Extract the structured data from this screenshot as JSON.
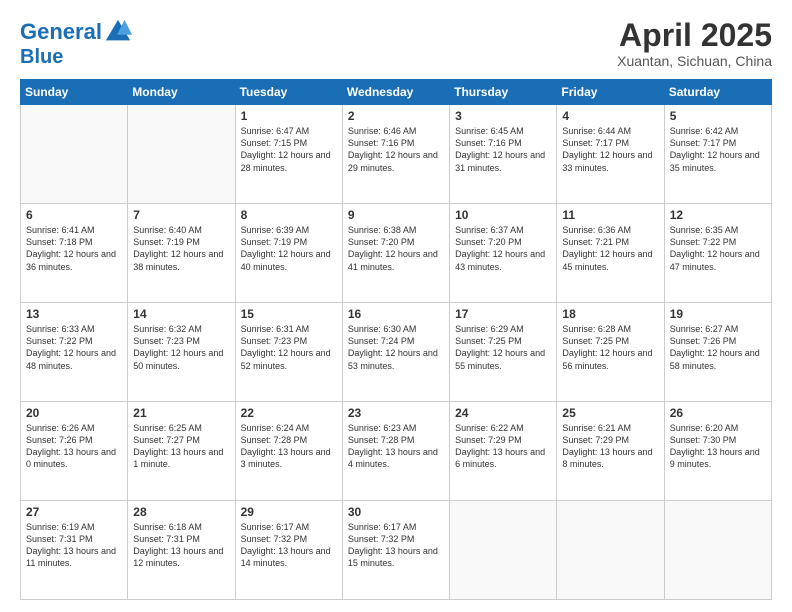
{
  "logo": {
    "line1": "General",
    "line2": "Blue"
  },
  "title": "April 2025",
  "subtitle": "Xuantan, Sichuan, China",
  "days_of_week": [
    "Sunday",
    "Monday",
    "Tuesday",
    "Wednesday",
    "Thursday",
    "Friday",
    "Saturday"
  ],
  "weeks": [
    [
      {
        "day": "",
        "info": ""
      },
      {
        "day": "",
        "info": ""
      },
      {
        "day": "1",
        "info": "Sunrise: 6:47 AM\nSunset: 7:15 PM\nDaylight: 12 hours and 28 minutes."
      },
      {
        "day": "2",
        "info": "Sunrise: 6:46 AM\nSunset: 7:16 PM\nDaylight: 12 hours and 29 minutes."
      },
      {
        "day": "3",
        "info": "Sunrise: 6:45 AM\nSunset: 7:16 PM\nDaylight: 12 hours and 31 minutes."
      },
      {
        "day": "4",
        "info": "Sunrise: 6:44 AM\nSunset: 7:17 PM\nDaylight: 12 hours and 33 minutes."
      },
      {
        "day": "5",
        "info": "Sunrise: 6:42 AM\nSunset: 7:17 PM\nDaylight: 12 hours and 35 minutes."
      }
    ],
    [
      {
        "day": "6",
        "info": "Sunrise: 6:41 AM\nSunset: 7:18 PM\nDaylight: 12 hours and 36 minutes."
      },
      {
        "day": "7",
        "info": "Sunrise: 6:40 AM\nSunset: 7:19 PM\nDaylight: 12 hours and 38 minutes."
      },
      {
        "day": "8",
        "info": "Sunrise: 6:39 AM\nSunset: 7:19 PM\nDaylight: 12 hours and 40 minutes."
      },
      {
        "day": "9",
        "info": "Sunrise: 6:38 AM\nSunset: 7:20 PM\nDaylight: 12 hours and 41 minutes."
      },
      {
        "day": "10",
        "info": "Sunrise: 6:37 AM\nSunset: 7:20 PM\nDaylight: 12 hours and 43 minutes."
      },
      {
        "day": "11",
        "info": "Sunrise: 6:36 AM\nSunset: 7:21 PM\nDaylight: 12 hours and 45 minutes."
      },
      {
        "day": "12",
        "info": "Sunrise: 6:35 AM\nSunset: 7:22 PM\nDaylight: 12 hours and 47 minutes."
      }
    ],
    [
      {
        "day": "13",
        "info": "Sunrise: 6:33 AM\nSunset: 7:22 PM\nDaylight: 12 hours and 48 minutes."
      },
      {
        "day": "14",
        "info": "Sunrise: 6:32 AM\nSunset: 7:23 PM\nDaylight: 12 hours and 50 minutes."
      },
      {
        "day": "15",
        "info": "Sunrise: 6:31 AM\nSunset: 7:23 PM\nDaylight: 12 hours and 52 minutes."
      },
      {
        "day": "16",
        "info": "Sunrise: 6:30 AM\nSunset: 7:24 PM\nDaylight: 12 hours and 53 minutes."
      },
      {
        "day": "17",
        "info": "Sunrise: 6:29 AM\nSunset: 7:25 PM\nDaylight: 12 hours and 55 minutes."
      },
      {
        "day": "18",
        "info": "Sunrise: 6:28 AM\nSunset: 7:25 PM\nDaylight: 12 hours and 56 minutes."
      },
      {
        "day": "19",
        "info": "Sunrise: 6:27 AM\nSunset: 7:26 PM\nDaylight: 12 hours and 58 minutes."
      }
    ],
    [
      {
        "day": "20",
        "info": "Sunrise: 6:26 AM\nSunset: 7:26 PM\nDaylight: 13 hours and 0 minutes."
      },
      {
        "day": "21",
        "info": "Sunrise: 6:25 AM\nSunset: 7:27 PM\nDaylight: 13 hours and 1 minute."
      },
      {
        "day": "22",
        "info": "Sunrise: 6:24 AM\nSunset: 7:28 PM\nDaylight: 13 hours and 3 minutes."
      },
      {
        "day": "23",
        "info": "Sunrise: 6:23 AM\nSunset: 7:28 PM\nDaylight: 13 hours and 4 minutes."
      },
      {
        "day": "24",
        "info": "Sunrise: 6:22 AM\nSunset: 7:29 PM\nDaylight: 13 hours and 6 minutes."
      },
      {
        "day": "25",
        "info": "Sunrise: 6:21 AM\nSunset: 7:29 PM\nDaylight: 13 hours and 8 minutes."
      },
      {
        "day": "26",
        "info": "Sunrise: 6:20 AM\nSunset: 7:30 PM\nDaylight: 13 hours and 9 minutes."
      }
    ],
    [
      {
        "day": "27",
        "info": "Sunrise: 6:19 AM\nSunset: 7:31 PM\nDaylight: 13 hours and 11 minutes."
      },
      {
        "day": "28",
        "info": "Sunrise: 6:18 AM\nSunset: 7:31 PM\nDaylight: 13 hours and 12 minutes."
      },
      {
        "day": "29",
        "info": "Sunrise: 6:17 AM\nSunset: 7:32 PM\nDaylight: 13 hours and 14 minutes."
      },
      {
        "day": "30",
        "info": "Sunrise: 6:17 AM\nSunset: 7:32 PM\nDaylight: 13 hours and 15 minutes."
      },
      {
        "day": "",
        "info": ""
      },
      {
        "day": "",
        "info": ""
      },
      {
        "day": "",
        "info": ""
      }
    ]
  ]
}
